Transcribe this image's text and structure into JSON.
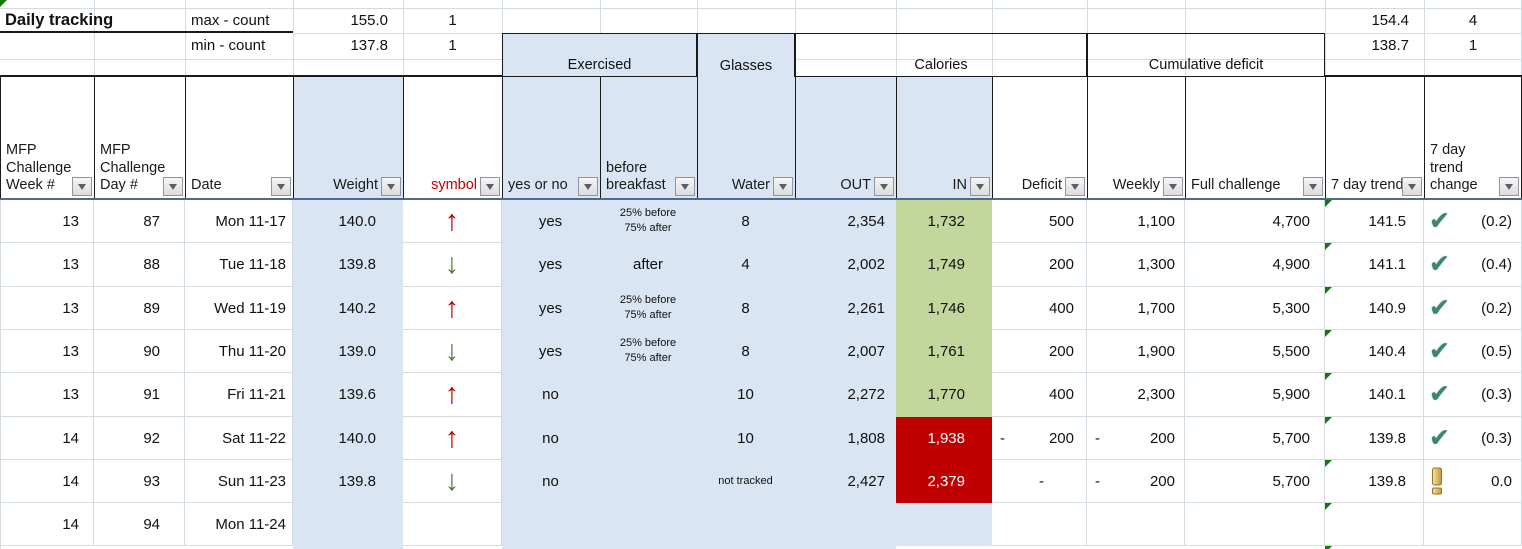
{
  "app": {
    "title": "Daily tracking"
  },
  "stats": {
    "left": {
      "max_label": "max - count",
      "max_value": "155.0",
      "max_count": "1",
      "min_label": "min - count",
      "min_value": "137.8",
      "min_count": "1"
    },
    "right": {
      "max_value": "154.4",
      "max_count": "4",
      "min_value": "138.7",
      "min_count": "1"
    }
  },
  "groups": {
    "exercised": "Exercised",
    "glasses": "Glasses",
    "calories": "Calories",
    "cumulative_deficit": "Cumulative deficit"
  },
  "columns": {
    "week": "MFP\nChallenge\nWeek #",
    "day": "MFP\nChallenge\nDay #",
    "date": "Date",
    "weight": "Weight",
    "symbol": "symbol",
    "exercised": "yes or no",
    "before_breakfast": "before\nbreakfast",
    "water": "Water",
    "out": "OUT",
    "in": "IN",
    "deficit": "Deficit",
    "weekly": "Weekly",
    "full": "Full challenge",
    "trend": "7 day trend",
    "trend_change": "7 day trend\nchange"
  },
  "icons": {
    "up": "↑",
    "down": "↓",
    "check": "✔",
    "warn": "exclamation",
    "filter": "▼"
  },
  "colors": {
    "accent_blue": "#D9E5F2",
    "good_green": "#C3D69B",
    "bad_red": "#C00000",
    "up_arrow_red": "#C00000",
    "down_arrow_green": "#4E7B2E",
    "check_teal": "#3A8672",
    "warn_gold": "#C49B3A",
    "indicator_green": "#0F7B0F",
    "symbol_header_red": "#C00000"
  },
  "rows": [
    {
      "week": "13",
      "day": "87",
      "date": "Mon 11-17",
      "weight": "140.0",
      "symbol": "up",
      "exercised": "yes",
      "before_breakfast": "25% before\n75% after",
      "water": "8",
      "out": "2,354",
      "in": "1,732",
      "in_state": "good",
      "deficit": "500",
      "weekly": "1,100",
      "full": "4,700",
      "trend": "141.5",
      "trend_icon": "check",
      "trend_change": "(0.2)"
    },
    {
      "week": "13",
      "day": "88",
      "date": "Tue 11-18",
      "weight": "139.8",
      "symbol": "down",
      "exercised": "yes",
      "before_breakfast": "after",
      "water": "4",
      "out": "2,002",
      "in": "1,749",
      "in_state": "good",
      "deficit": "200",
      "weekly": "1,300",
      "full": "4,900",
      "trend": "141.1",
      "trend_icon": "check",
      "trend_change": "(0.4)"
    },
    {
      "week": "13",
      "day": "89",
      "date": "Wed 11-19",
      "weight": "140.2",
      "symbol": "up",
      "exercised": "yes",
      "before_breakfast": "25% before\n75% after",
      "water": "8",
      "out": "2,261",
      "in": "1,746",
      "in_state": "good",
      "deficit": "400",
      "weekly": "1,700",
      "full": "5,300",
      "trend": "140.9",
      "trend_icon": "check",
      "trend_change": "(0.2)"
    },
    {
      "week": "13",
      "day": "90",
      "date": "Thu 11-20",
      "weight": "139.0",
      "symbol": "down",
      "exercised": "yes",
      "before_breakfast": "25% before\n75% after",
      "water": "8",
      "out": "2,007",
      "in": "1,761",
      "in_state": "good",
      "deficit": "200",
      "weekly": "1,900",
      "full": "5,500",
      "trend": "140.4",
      "trend_icon": "check",
      "trend_change": "(0.5)"
    },
    {
      "week": "13",
      "day": "91",
      "date": "Fri 11-21",
      "weight": "139.6",
      "symbol": "up",
      "exercised": "no",
      "before_breakfast": "",
      "water": "10",
      "out": "2,272",
      "in": "1,770",
      "in_state": "good",
      "deficit": "400",
      "weekly": "2,300",
      "full": "5,900",
      "trend": "140.1",
      "trend_icon": "check",
      "trend_change": "(0.3)"
    },
    {
      "week": "14",
      "day": "92",
      "date": "Sat 11-22",
      "weight": "140.0",
      "symbol": "up",
      "exercised": "no",
      "before_breakfast": "",
      "water": "10",
      "out": "1,808",
      "in": "1,938",
      "in_state": "bad",
      "deficit": "200",
      "deficit_neg": true,
      "weekly": "200",
      "weekly_neg": true,
      "full": "5,700",
      "trend": "139.8",
      "trend_icon": "check",
      "trend_change": "(0.3)"
    },
    {
      "week": "14",
      "day": "93",
      "date": "Sun 11-23",
      "weight": "139.8",
      "symbol": "down",
      "exercised": "no",
      "before_breakfast": "",
      "water": "not tracked",
      "out": "2,427",
      "in": "2,379",
      "in_state": "bad",
      "deficit": "-",
      "weekly": "200",
      "weekly_neg": true,
      "full": "5,700",
      "trend": "139.8",
      "trend_icon": "warn",
      "trend_change": "0.0"
    },
    {
      "week": "14",
      "day": "94",
      "date": "Mon 11-24",
      "weight": "",
      "symbol": "",
      "exercised": "",
      "before_breakfast": "",
      "water": "",
      "out": "",
      "in": "",
      "in_state": "",
      "deficit": "",
      "weekly": "",
      "full": "",
      "trend": "",
      "trend_icon": "",
      "trend_change": ""
    }
  ]
}
